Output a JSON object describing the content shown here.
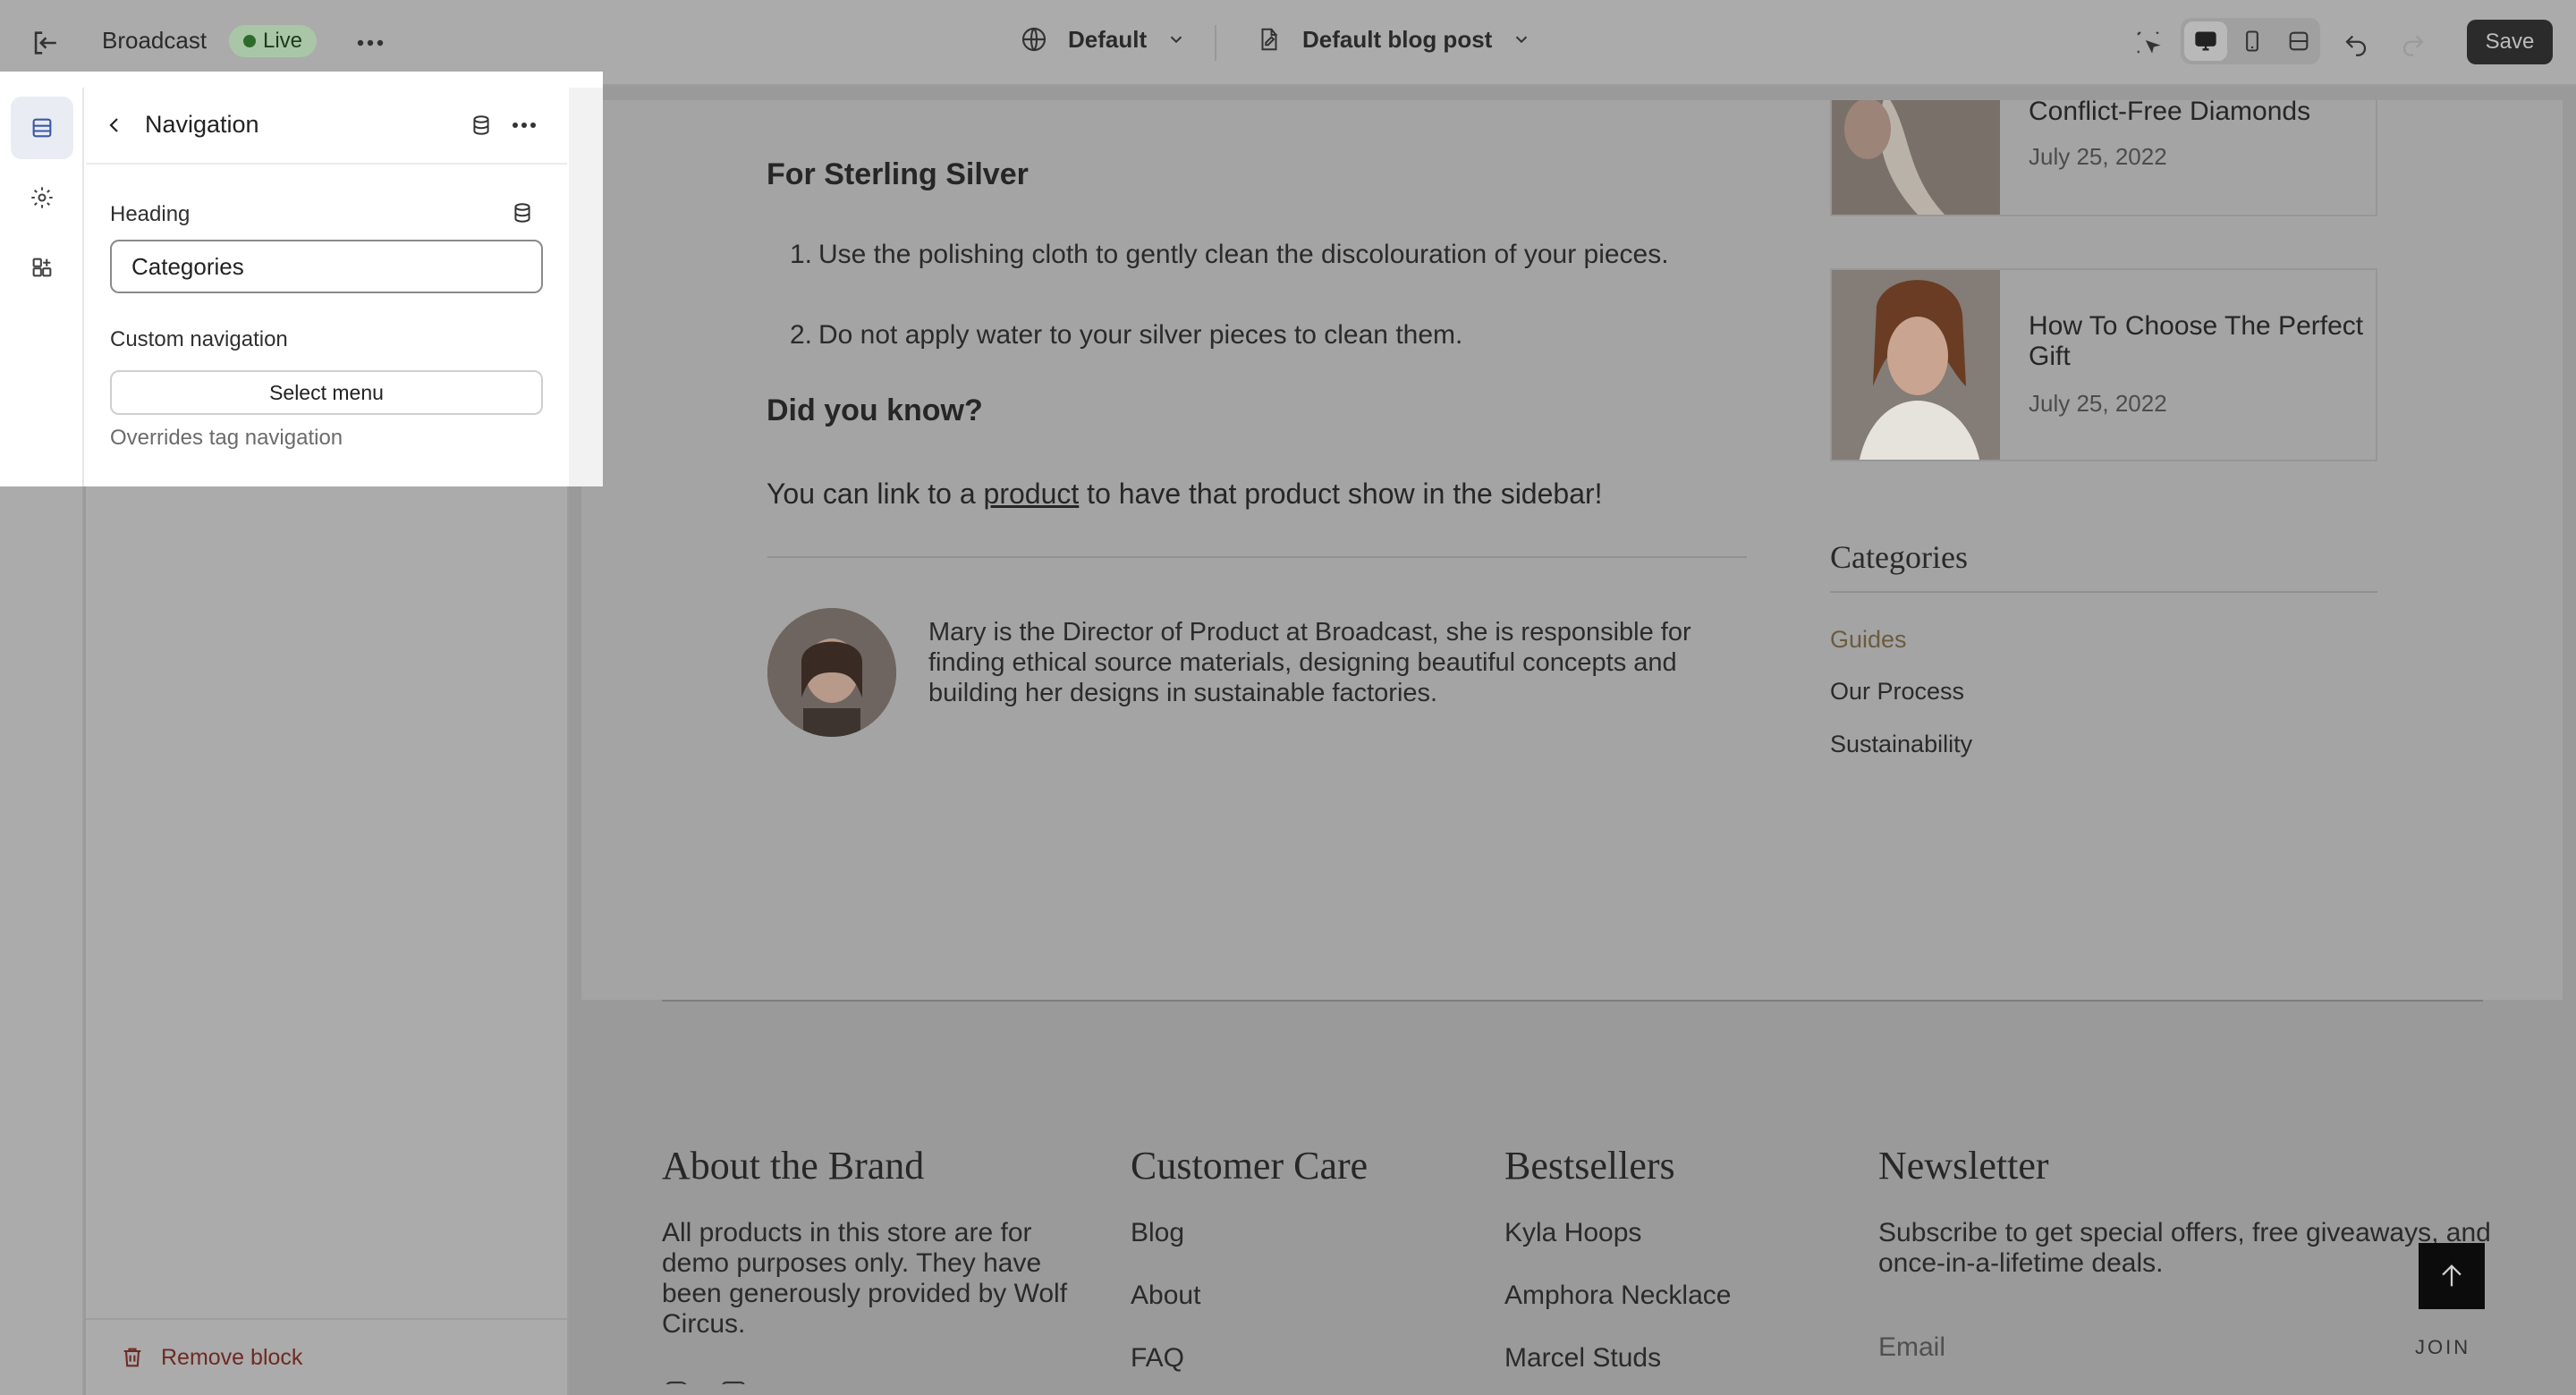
{
  "topbar": {
    "store_name": "Broadcast",
    "status": "Live",
    "theme_label": "Default",
    "template_label": "Default blog post",
    "save_label": "Save"
  },
  "panel": {
    "title": "Navigation",
    "heading_label": "Heading",
    "heading_value": "Categories",
    "custom_nav_label": "Custom navigation",
    "select_menu_label": "Select menu",
    "helper_text": "Overrides tag navigation",
    "remove_block_label": "Remove block"
  },
  "article": {
    "sterling_heading": "For Sterling Silver",
    "steps": [
      "Use the polishing cloth to gently clean the discolouration of your pieces.",
      "Do not apply water to your silver pieces to clean them."
    ],
    "step_numbers": [
      "1.",
      "2."
    ],
    "did_you_know": "Did you know?",
    "link_before": "You can link to a ",
    "link_word": "product",
    "link_after": " to have that product show in the sidebar!",
    "author_bio": "Mary is the Director of Product at Broadcast, she is responsible for finding ethical source materials, designing beautiful concepts and building her designs in sustainable factories."
  },
  "sidebar_posts": [
    {
      "title": "Conflict-Free Diamonds",
      "date": "July 25, 2022"
    },
    {
      "title": "How To Choose The Perfect Gift",
      "date": "July 25, 2022"
    }
  ],
  "categories": {
    "heading": "Categories",
    "items": [
      "Guides",
      "Our Process",
      "Sustainability"
    ]
  },
  "footer": {
    "about_heading": "About the Brand",
    "about_text": "All products in this store are for demo purposes only. They have been generously provided by Wolf Circus.",
    "care_heading": "Customer Care",
    "care_links": [
      "Blog",
      "About",
      "FAQ"
    ],
    "best_heading": "Bestsellers",
    "best_links": [
      "Kyla Hoops",
      "Amphora Necklace",
      "Marcel Studs"
    ],
    "news_heading": "Newsletter",
    "news_text": "Subscribe to get special offers, free giveaways, and once-in-a-lifetime deals.",
    "email_placeholder": "Email",
    "join_label": "JOIN"
  },
  "colors": {
    "live_green": "#2e6b2b",
    "accent_link": "#6b5b3f",
    "remove_red": "#6e2a24",
    "save_bg": "#2b2b2b"
  }
}
